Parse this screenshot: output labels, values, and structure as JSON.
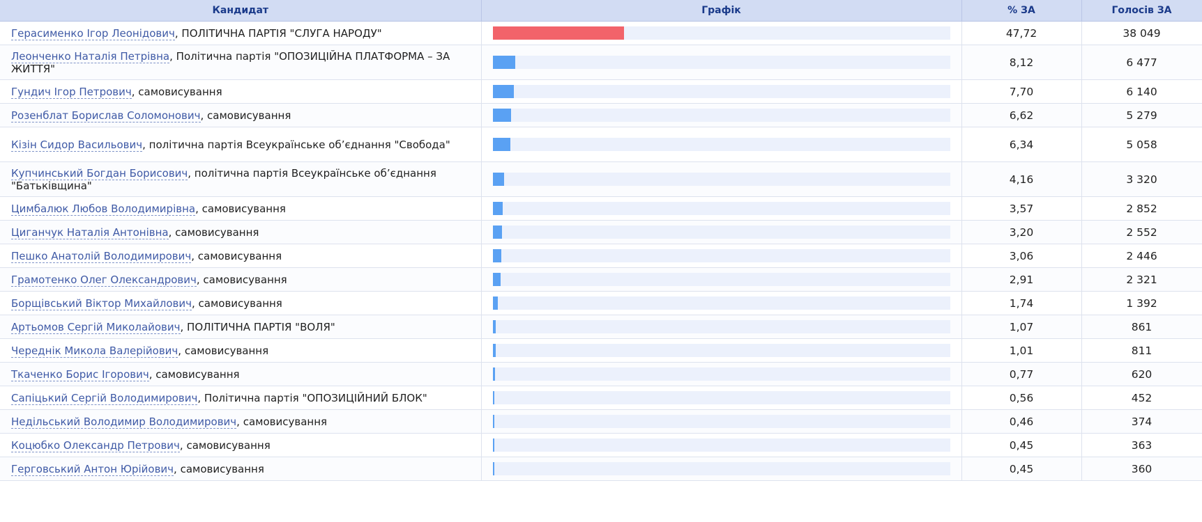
{
  "table": {
    "headers": {
      "candidate": "Кандидат",
      "graph": "Графік",
      "percent": "% ЗА",
      "votes": "Голосів ЗА"
    },
    "colors": {
      "leader_bar": "#f2636a",
      "bar": "#5aa1f3",
      "bar_track": "#ecf1fc",
      "header_bg": "#d2dcf3",
      "header_text": "#1a3a8a",
      "link": "#3f5aa6"
    },
    "rows": [
      {
        "name": "Герасименко Ігор Леонідович",
        "party": ", ПОЛІТИЧНА ПАРТІЯ \"СЛУГА НАРОДУ\"",
        "percent": "47,72",
        "votes": "38 049",
        "share": 47.72
      },
      {
        "name": "Леонченко Наталія Петрівна",
        "party": ", Політична партія \"ОПОЗИЦІЙНА ПЛАТФОРМА – ЗА ЖИТТЯ\"",
        "percent": "8,12",
        "votes": "6 477",
        "share": 8.12
      },
      {
        "name": "Гундич Ігор Петрович",
        "party": ", самовисування",
        "percent": "7,70",
        "votes": "6 140",
        "share": 7.7
      },
      {
        "name": "Розенблат Борислав Соломонович",
        "party": ", самовисування",
        "percent": "6,62",
        "votes": "5 279",
        "share": 6.62
      },
      {
        "name": "Кізін Сидор Васильович",
        "party": ", політична партія Всеукраїнське об’єднання \"Свобода\"",
        "percent": "6,34",
        "votes": "5 058",
        "share": 6.34
      },
      {
        "name": "Купчинський Богдан Борисович",
        "party": ", політична партія Всеукраїнське об’єднання \"Батьківщина\"",
        "percent": "4,16",
        "votes": "3 320",
        "share": 4.16
      },
      {
        "name": "Цимбалюк Любов Володимирівна",
        "party": ", самовисування",
        "percent": "3,57",
        "votes": "2 852",
        "share": 3.57
      },
      {
        "name": "Циганчук Наталія Антонівна",
        "party": ", самовисування",
        "percent": "3,20",
        "votes": "2 552",
        "share": 3.2
      },
      {
        "name": "Пешко Анатолій Володимирович",
        "party": ", самовисування",
        "percent": "3,06",
        "votes": "2 446",
        "share": 3.06
      },
      {
        "name": "Грамотенко Олег Олександрович",
        "party": ", самовисування",
        "percent": "2,91",
        "votes": "2 321",
        "share": 2.91
      },
      {
        "name": "Борщівський Віктор Михайлович",
        "party": ", самовисування",
        "percent": "1,74",
        "votes": "1 392",
        "share": 1.74
      },
      {
        "name": "Артьомов Сергій Миколайович",
        "party": ", ПОЛІТИЧНА ПАРТІЯ \"ВОЛЯ\"",
        "percent": "1,07",
        "votes": "861",
        "share": 1.07
      },
      {
        "name": "Череднік Микола Валерійович",
        "party": ", самовисування",
        "percent": "1,01",
        "votes": "811",
        "share": 1.01
      },
      {
        "name": "Ткаченко Борис Ігорович",
        "party": ", самовисування",
        "percent": "0,77",
        "votes": "620",
        "share": 0.77
      },
      {
        "name": "Сапіцький Сергій Володимирович",
        "party": ", Політична партія \"ОПОЗИЦІЙНИЙ БЛОК\"",
        "percent": "0,56",
        "votes": "452",
        "share": 0.56
      },
      {
        "name": "Недільський Володимир Володимирович",
        "party": ", самовисування",
        "percent": "0,46",
        "votes": "374",
        "share": 0.46
      },
      {
        "name": "Коцюбко Олександр Петрович",
        "party": ", самовисування",
        "percent": "0,45",
        "votes": "363",
        "share": 0.45
      },
      {
        "name": "Герговський Антон Юрійович",
        "party": ", самовисування",
        "percent": "0,45",
        "votes": "360",
        "share": 0.45
      }
    ]
  }
}
